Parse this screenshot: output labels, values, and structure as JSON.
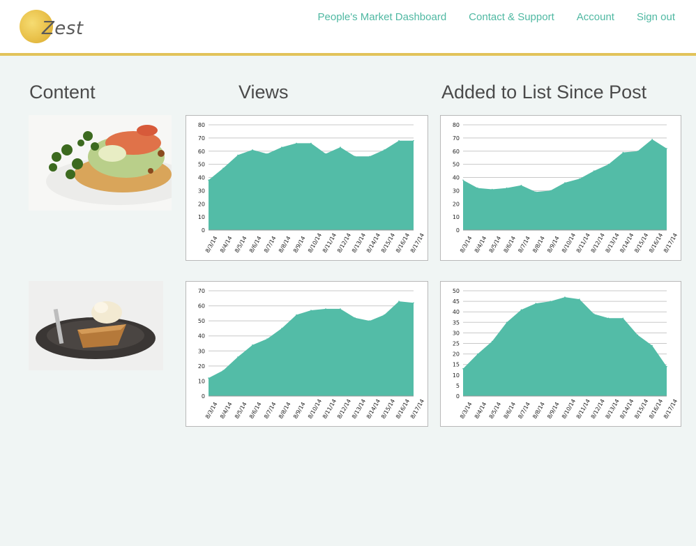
{
  "brand": {
    "name": "Zest"
  },
  "nav": {
    "items": [
      "People's Market Dashboard",
      "Contact & Support",
      "Account",
      "Sign out"
    ]
  },
  "columns": {
    "content": "Content",
    "views": "Views",
    "added": "Added to List Since Post"
  },
  "colors": {
    "accent": "#53bca7",
    "gold": "#e2c35a",
    "link": "#4fb8a2"
  },
  "rows": [
    {
      "image_name": "taco-plate-photo"
    },
    {
      "image_name": "pie-slice-photo"
    }
  ],
  "chart_data": [
    {
      "type": "area",
      "categories": [
        "8/3/14",
        "8/4/14",
        "8/5/14",
        "8/6/14",
        "8/7/14",
        "8/8/14",
        "8/9/14",
        "8/10/14",
        "8/11/14",
        "8/12/14",
        "8/13/14",
        "8/14/14",
        "8/15/14",
        "8/16/14",
        "8/17/14"
      ],
      "yticks": [
        "0",
        "10",
        "20",
        "30",
        "40",
        "50",
        "60",
        "70",
        "80"
      ],
      "ylim": [
        0,
        80
      ],
      "values": [
        38,
        47,
        57,
        61,
        58,
        63,
        66,
        66,
        58,
        63,
        56,
        56,
        61,
        68,
        68
      ],
      "grid": true
    },
    {
      "type": "area",
      "categories": [
        "8/3/14",
        "8/4/14",
        "8/5/14",
        "8/6/14",
        "8/7/14",
        "8/8/14",
        "8/9/14",
        "8/10/14",
        "8/11/14",
        "8/12/14",
        "8/13/14",
        "8/14/14",
        "8/15/14",
        "8/16/14",
        "8/17/14"
      ],
      "yticks": [
        "0",
        "10",
        "20",
        "30",
        "40",
        "50",
        "60",
        "70",
        "80"
      ],
      "ylim": [
        0,
        80
      ],
      "values": [
        38,
        32,
        31,
        32,
        34,
        29,
        30,
        36,
        39,
        45,
        50,
        59,
        60,
        69,
        62
      ],
      "grid": true
    },
    {
      "type": "area",
      "categories": [
        "8/3/14",
        "8/4/14",
        "8/5/14",
        "8/6/14",
        "8/7/14",
        "8/8/14",
        "8/9/14",
        "8/10/14",
        "8/11/14",
        "8/12/14",
        "8/13/14",
        "8/14/14",
        "8/15/14",
        "8/16/14",
        "8/17/14"
      ],
      "yticks": [
        "0",
        "10",
        "20",
        "30",
        "40",
        "50",
        "60",
        "70"
      ],
      "ylim": [
        0,
        70
      ],
      "values": [
        12,
        17,
        26,
        34,
        38,
        45,
        54,
        57,
        58,
        58,
        52,
        50,
        54,
        63,
        62
      ],
      "grid": true
    },
    {
      "type": "area",
      "categories": [
        "8/3/14",
        "8/4/14",
        "8/5/14",
        "8/6/14",
        "8/7/14",
        "8/8/14",
        "8/9/14",
        "8/10/14",
        "8/11/14",
        "8/12/14",
        "8/13/14",
        "8/14/14",
        "8/15/14",
        "8/16/14",
        "8/17/14"
      ],
      "yticks": [
        "0",
        "5",
        "10",
        "15",
        "20",
        "25",
        "30",
        "35",
        "40",
        "45",
        "50"
      ],
      "ylim": [
        0,
        50
      ],
      "values": [
        13,
        20,
        26,
        35,
        41,
        44,
        45,
        47,
        46,
        39,
        37,
        37,
        29,
        24,
        14
      ],
      "grid": true
    }
  ]
}
